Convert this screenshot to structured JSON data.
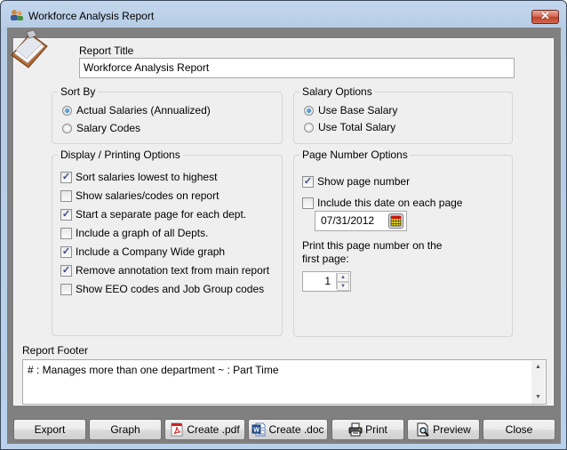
{
  "window": {
    "title": "Workforce Analysis Report",
    "close_glyph": "✕"
  },
  "report_title": {
    "label": "Report Title",
    "value": "Workforce Analysis Report"
  },
  "sort_by": {
    "title": "Sort By",
    "options": [
      {
        "label": "Actual Salaries (Annualized)",
        "selected": true
      },
      {
        "label": "Salary Codes",
        "selected": false
      }
    ]
  },
  "salary_options": {
    "title": "Salary Options",
    "options": [
      {
        "label": "Use Base Salary",
        "selected": true
      },
      {
        "label": "Use Total Salary",
        "selected": false
      }
    ]
  },
  "display_printing": {
    "title": "Display / Printing Options",
    "options": [
      {
        "label": "Sort salaries lowest to highest",
        "checked": true
      },
      {
        "label": "Show salaries/codes on report",
        "checked": false
      },
      {
        "label": "Start a separate page for each dept.",
        "checked": true
      },
      {
        "label": "Include a graph of all Depts.",
        "checked": false
      },
      {
        "label": "Include a Company Wide graph",
        "checked": true
      },
      {
        "label": "Remove annotation text from main report",
        "checked": true
      },
      {
        "label": "Show EEO codes and Job Group codes",
        "checked": false
      }
    ]
  },
  "page_number": {
    "title": "Page Number Options",
    "show_page_number": {
      "label": "Show page number",
      "checked": true
    },
    "include_date": {
      "label": "Include this date on each page",
      "checked": false
    },
    "date_value": "07/31/2012",
    "first_page_label_line1": "Print this page number on the",
    "first_page_label_line2": "first page:",
    "first_page_value": "1"
  },
  "report_footer": {
    "label": "Report Footer",
    "value": "# : Manages more than one department  ~ : Part Time"
  },
  "buttons": {
    "export": "Export",
    "graph": "Graph",
    "create_pdf": "Create .pdf",
    "create_doc": "Create .doc",
    "print": "Print",
    "preview": "Preview",
    "close": "Close"
  },
  "check_glyph": "✓",
  "spin_up": "▲",
  "spin_down": "▼",
  "colors": {
    "title_bar": "#b9d1ea",
    "frame": "#808080",
    "panel": "#efefef",
    "close_button": "#c74a33"
  }
}
